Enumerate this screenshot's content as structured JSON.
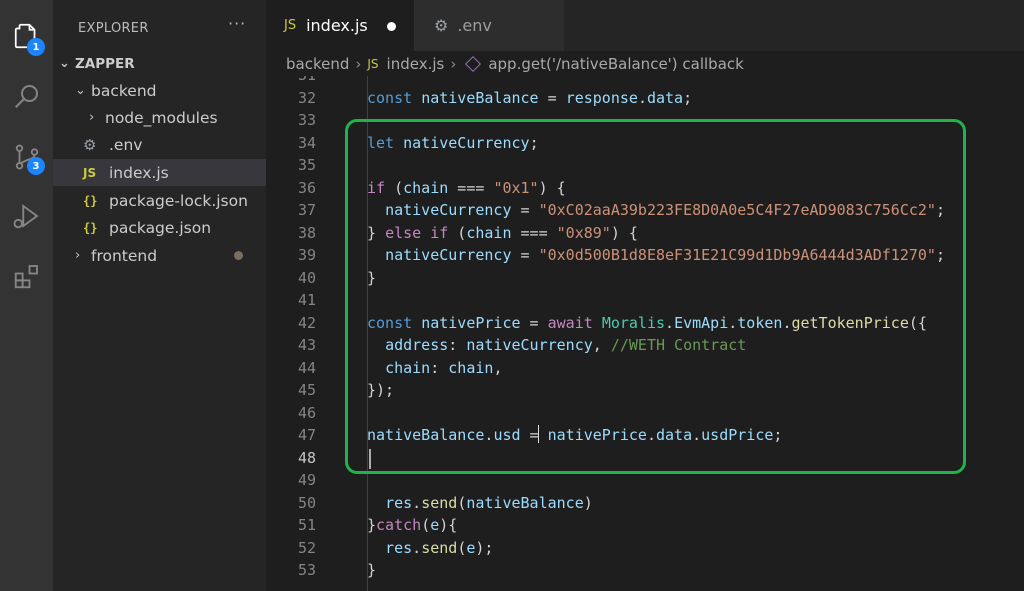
{
  "activity_bar": {
    "items": [
      {
        "name": "explorer",
        "icon": "files-icon",
        "badge": "1"
      },
      {
        "name": "search",
        "icon": "search-icon"
      },
      {
        "name": "source-control",
        "icon": "source-control-icon",
        "badge": "3"
      },
      {
        "name": "run-debug",
        "icon": "run-debug-icon"
      },
      {
        "name": "extensions",
        "icon": "extensions-icon"
      }
    ]
  },
  "sidebar": {
    "title": "EXPLORER",
    "more": "···",
    "tree": [
      {
        "label": "ZAPPER",
        "chevron": "⌄",
        "icon": ""
      },
      {
        "label": "backend",
        "chevron": "⌄",
        "icon": ""
      },
      {
        "label": "node_modules",
        "chevron": "›",
        "icon": ""
      },
      {
        "label": ".env",
        "chevron": "",
        "icon": "⚙"
      },
      {
        "label": "index.js",
        "chevron": "",
        "icon": "JS"
      },
      {
        "label": "package-lock.json",
        "chevron": "",
        "icon": "{}"
      },
      {
        "label": "package.json",
        "chevron": "",
        "icon": "{}"
      },
      {
        "label": "frontend",
        "chevron": "›",
        "icon": ""
      }
    ]
  },
  "tabs": [
    {
      "label": "index.js",
      "icon": "JS"
    },
    {
      "label": ".env",
      "icon": "⚙"
    }
  ],
  "breadcrumb": {
    "folder": "backend",
    "file_icon": "JS",
    "file": "index.js",
    "symbol": "app.get('/nativeBalance') callback",
    "sep": "›"
  },
  "editor": {
    "lines": [
      {
        "n": "31",
        "tokens": []
      },
      {
        "n": "32",
        "tokens": [
          [
            "kw",
            "const "
          ],
          [
            "var",
            "nativeBalance"
          ],
          [
            "pun",
            " = "
          ],
          [
            "var",
            "response"
          ],
          [
            "pun",
            "."
          ],
          [
            "var",
            "data"
          ],
          [
            "pun",
            ";"
          ]
        ]
      },
      {
        "n": "33",
        "tokens": []
      },
      {
        "n": "34",
        "tokens": [
          [
            "kw",
            "let "
          ],
          [
            "var",
            "nativeCurrency"
          ],
          [
            "pun",
            ";"
          ]
        ]
      },
      {
        "n": "35",
        "tokens": []
      },
      {
        "n": "36",
        "tokens": [
          [
            "ctl",
            "if"
          ],
          [
            "pun",
            " ("
          ],
          [
            "var",
            "chain"
          ],
          [
            "pun",
            " === "
          ],
          [
            "str",
            "\"0x1\""
          ],
          [
            "pun",
            ") {"
          ]
        ]
      },
      {
        "n": "37",
        "tokens": [
          [
            "pun",
            "  "
          ],
          [
            "var",
            "nativeCurrency"
          ],
          [
            "pun",
            " = "
          ],
          [
            "str",
            "\"0xC02aaA39b223FE8D0A0e5C4F27eAD9083C756Cc2\""
          ],
          [
            "pun",
            ";"
          ]
        ]
      },
      {
        "n": "38",
        "tokens": [
          [
            "pun",
            "} "
          ],
          [
            "ctl",
            "else if"
          ],
          [
            "pun",
            " ("
          ],
          [
            "var",
            "chain"
          ],
          [
            "pun",
            " === "
          ],
          [
            "str",
            "\"0x89\""
          ],
          [
            "pun",
            ") {"
          ]
        ]
      },
      {
        "n": "39",
        "tokens": [
          [
            "pun",
            "  "
          ],
          [
            "var",
            "nativeCurrency"
          ],
          [
            "pun",
            " = "
          ],
          [
            "str",
            "\"0x0d500B1d8E8eF31E21C99d1Db9A6444d3ADf1270\""
          ],
          [
            "pun",
            ";"
          ]
        ]
      },
      {
        "n": "40",
        "tokens": [
          [
            "pun",
            "}"
          ]
        ]
      },
      {
        "n": "41",
        "tokens": []
      },
      {
        "n": "42",
        "tokens": [
          [
            "kw",
            "const "
          ],
          [
            "var",
            "nativePrice"
          ],
          [
            "pun",
            " = "
          ],
          [
            "ctl",
            "await "
          ],
          [
            "cls",
            "Moralis"
          ],
          [
            "pun",
            "."
          ],
          [
            "var",
            "EvmApi"
          ],
          [
            "pun",
            "."
          ],
          [
            "var",
            "token"
          ],
          [
            "pun",
            "."
          ],
          [
            "fn",
            "getTokenPrice"
          ],
          [
            "pun",
            "({"
          ]
        ]
      },
      {
        "n": "43",
        "tokens": [
          [
            "pun",
            "  "
          ],
          [
            "var",
            "address"
          ],
          [
            "pun",
            ": "
          ],
          [
            "var",
            "nativeCurrency"
          ],
          [
            "pun",
            ", "
          ],
          [
            "cmt",
            "//WETH Contract"
          ]
        ]
      },
      {
        "n": "44",
        "tokens": [
          [
            "pun",
            "  "
          ],
          [
            "var",
            "chain"
          ],
          [
            "pun",
            ": "
          ],
          [
            "var",
            "chain"
          ],
          [
            "pun",
            ","
          ]
        ]
      },
      {
        "n": "45",
        "tokens": [
          [
            "pun",
            "});"
          ]
        ]
      },
      {
        "n": "46",
        "tokens": []
      },
      {
        "n": "47",
        "tokens": [
          [
            "var",
            "nativeBalance"
          ],
          [
            "pun",
            "."
          ],
          [
            "var",
            "usd"
          ],
          [
            "pun",
            " = "
          ],
          [
            "var",
            "nativePrice"
          ],
          [
            "pun",
            "."
          ],
          [
            "var",
            "data"
          ],
          [
            "pun",
            "."
          ],
          [
            "var",
            "usdPrice"
          ],
          [
            "pun",
            ";"
          ]
        ]
      },
      {
        "n": "48",
        "tokens": []
      },
      {
        "n": "49",
        "tokens": []
      },
      {
        "n": "50",
        "tokens": [
          [
            "pun",
            "  "
          ],
          [
            "var",
            "res"
          ],
          [
            "pun",
            "."
          ],
          [
            "fn",
            "send"
          ],
          [
            "pun",
            "("
          ],
          [
            "var",
            "nativeBalance"
          ],
          [
            "pun",
            ")"
          ]
        ]
      },
      {
        "n": "51",
        "tokens": [
          [
            "pun",
            "}"
          ],
          [
            "ctl",
            "catch"
          ],
          [
            "pun",
            "("
          ],
          [
            "var",
            "e"
          ],
          [
            "pun",
            "){"
          ]
        ]
      },
      {
        "n": "52",
        "tokens": [
          [
            "pun",
            "  "
          ],
          [
            "var",
            "res"
          ],
          [
            "pun",
            "."
          ],
          [
            "fn",
            "send"
          ],
          [
            "pun",
            "("
          ],
          [
            "var",
            "e"
          ],
          [
            "pun",
            ");"
          ]
        ]
      },
      {
        "n": "53",
        "tokens": [
          [
            "pun",
            "}"
          ]
        ]
      }
    ]
  },
  "colors": {
    "highlight_box": "#22b24c",
    "badge": "#1a85ff"
  }
}
